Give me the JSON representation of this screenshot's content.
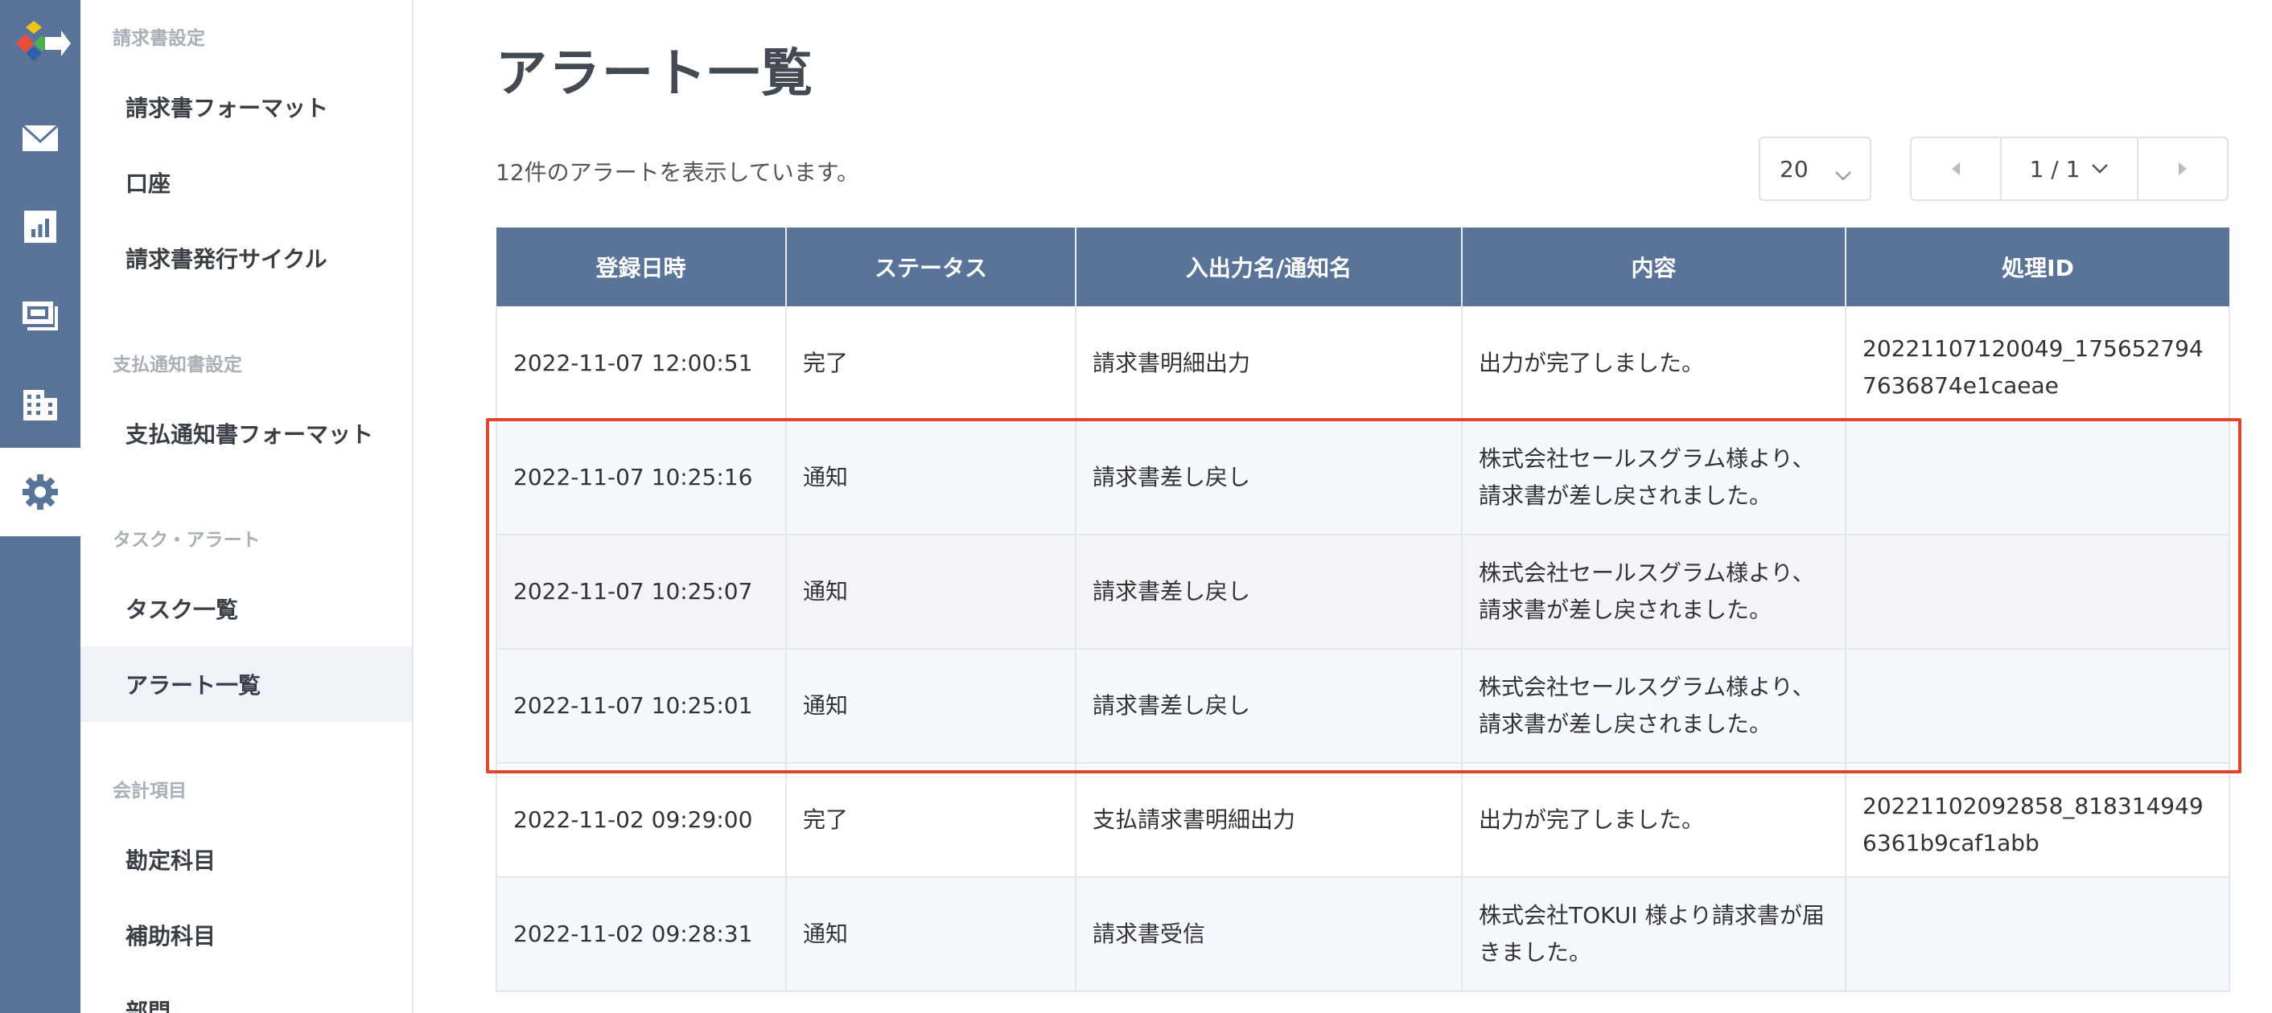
{
  "sidebar": {
    "sections": [
      {
        "label": "請求書設定",
        "items": [
          "請求書フォーマット",
          "口座",
          "請求書発行サイクル"
        ]
      },
      {
        "label": "支払通知書設定",
        "items": [
          "支払通知書フォーマット"
        ]
      },
      {
        "label": "タスク・アラート",
        "items": [
          "タスク一覧",
          "アラート一覧"
        ]
      },
      {
        "label": "会計項目",
        "items": [
          "勘定科目",
          "補助科目",
          "部門"
        ]
      }
    ],
    "selected": "アラート一覧"
  },
  "rail": {
    "icons": [
      "logo-icon",
      "mail-icon",
      "chart-icon",
      "invoice-icon",
      "building-icon",
      "gear-icon"
    ],
    "active": "gear-icon"
  },
  "main": {
    "title": "アラート一覧",
    "count_text": "12件のアラートを表示しています。",
    "per_page": "20",
    "page_label": "1 / 1"
  },
  "table": {
    "headers": [
      "登録日時",
      "ステータス",
      "入出力名/通知名",
      "内容",
      "処理ID"
    ],
    "rows": [
      [
        "2022-11-07 12:00:51",
        "完了",
        "請求書明細出力",
        "出力が完了しました。",
        "20221107120049_1756527947636874e1caeae"
      ],
      [
        "2022-11-07 10:25:16",
        "通知",
        "請求書差し戻し",
        "株式会社セールスグラム様より、請求書が差し戻されました。",
        ""
      ],
      [
        "2022-11-07 10:25:07",
        "通知",
        "請求書差し戻し",
        "株式会社セールスグラム様より、請求書が差し戻されました。",
        ""
      ],
      [
        "2022-11-07 10:25:01",
        "通知",
        "請求書差し戻し",
        "株式会社セールスグラム様より、請求書が差し戻されました。",
        ""
      ],
      [
        "2022-11-02 09:29:00",
        "完了",
        "支払請求書明細出力",
        "出力が完了しました。",
        "20221102092858_8183149496361b9caf1abb"
      ],
      [
        "2022-11-02 09:28:31",
        "通知",
        "請求書受信",
        "株式会社TOKUI 様より請求書が届きました。",
        ""
      ]
    ]
  },
  "colors": {
    "rail": "#5a7499",
    "header": "#5a7499",
    "highlight": "#e3452c"
  }
}
